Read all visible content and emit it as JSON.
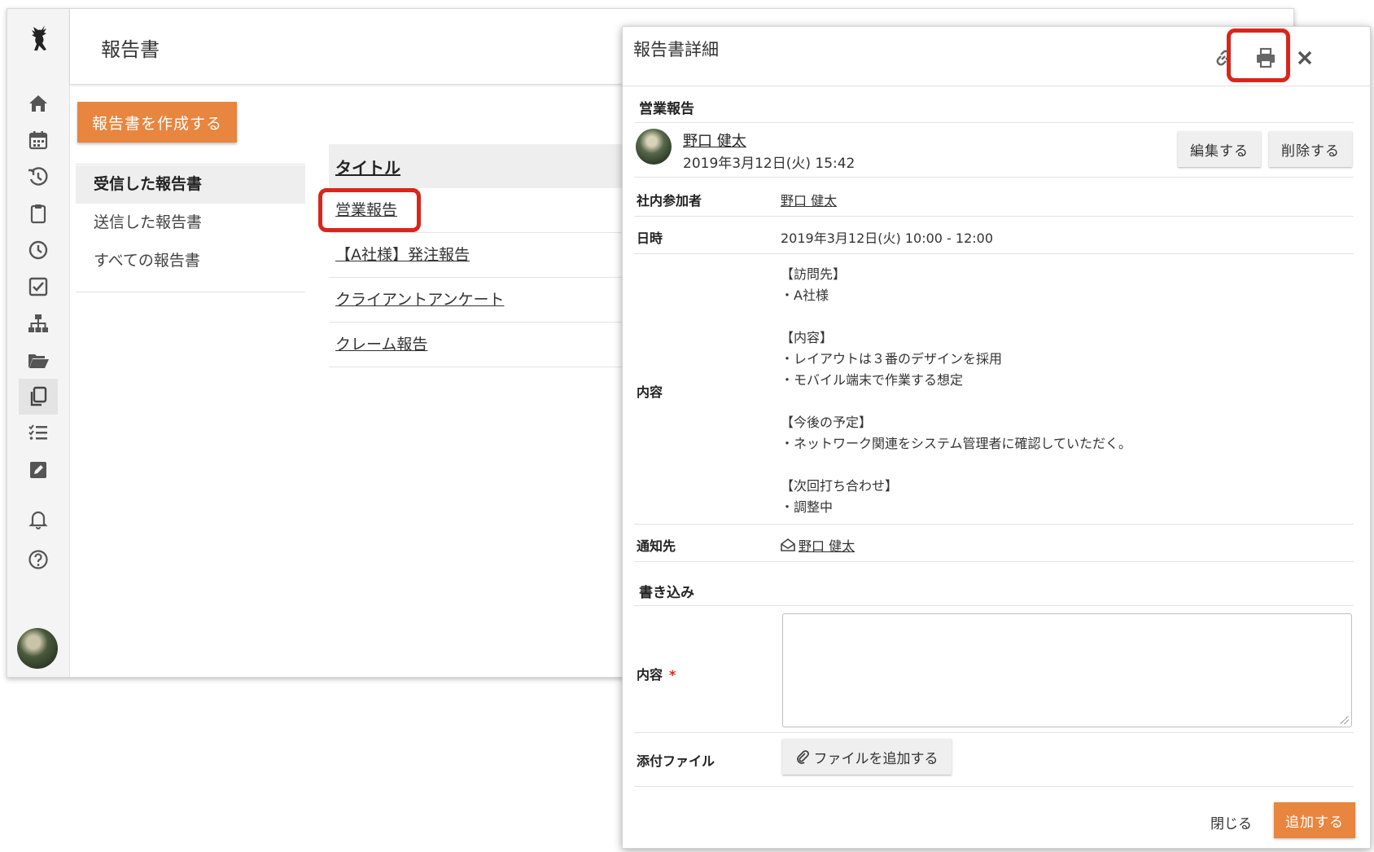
{
  "app": {
    "title": "報告書",
    "create_button": "報告書を作成する",
    "filters": [
      {
        "label": "受信した報告書",
        "active": true
      },
      {
        "label": "送信した報告書",
        "active": false
      },
      {
        "label": "すべての報告書",
        "active": false
      }
    ],
    "table": {
      "header": "タイトル",
      "rows": [
        "営業報告",
        "【A社様】発注報告",
        "クライアントアンケート",
        "クレーム報告"
      ]
    },
    "sidebar_icons": [
      "home-icon",
      "calendar-icon",
      "history-icon",
      "clipboard-icon",
      "clock-icon",
      "checkbox-icon",
      "org-chart-icon",
      "folder-open-icon",
      "copy-icon",
      "task-list-icon",
      "edit-icon",
      "bell-icon",
      "help-icon"
    ]
  },
  "panel": {
    "title": "報告書詳細",
    "report_title": "営業報告",
    "author": {
      "name": "野口 健太",
      "datetime": "2019年3月12日(火) 15:42"
    },
    "edit_button": "編集する",
    "delete_button": "削除する",
    "fields": {
      "participants_label": "社内参加者",
      "participants_value": "野口 健太",
      "datetime_label": "日時",
      "datetime_value": "2019年3月12日(火) 10:00 - 12:00",
      "content_label": "内容",
      "content_lines": [
        "【訪問先】",
        "・A社様",
        "",
        "【内容】",
        "・レイアウトは３番のデザインを採用",
        "・モバイル端末で作業する想定",
        "",
        "【今後の予定】",
        "・ネットワーク関連をシステム管理者に確認していただく。",
        "",
        "【次回打ち合わせ】",
        "・調整中"
      ],
      "notify_label": "通知先",
      "notify_value": "野口 健太"
    },
    "comment": {
      "section_title": "書き込み",
      "content_label": "内容",
      "required_mark": "*",
      "attachment_label": "添付ファイル",
      "attach_button": "ファイルを追加する"
    },
    "footer": {
      "close": "閉じる",
      "add": "追加する"
    }
  },
  "colors": {
    "accent": "#e8853f",
    "highlight": "#d8261c"
  }
}
